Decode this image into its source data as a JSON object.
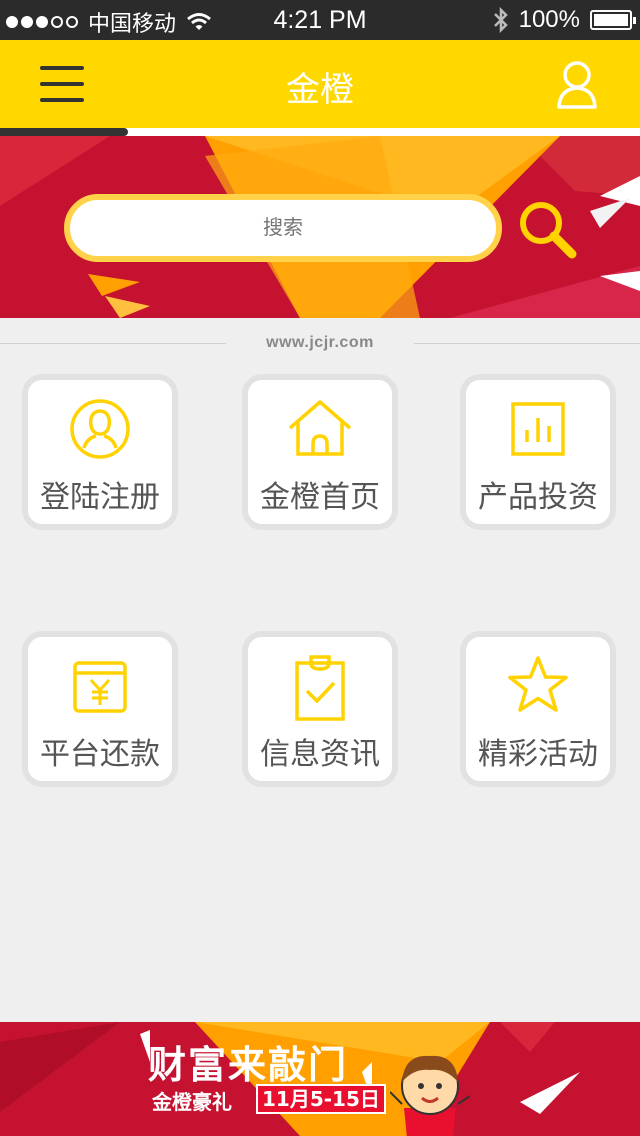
{
  "status_bar": {
    "carrier": "中国移动",
    "time": "4:21 PM",
    "battery": "100%"
  },
  "header": {
    "title": "金橙"
  },
  "search": {
    "placeholder": "搜索"
  },
  "site_url": "www.jcjr.com",
  "tiles": [
    {
      "label": "登陆注册",
      "icon": "user-circle-icon"
    },
    {
      "label": "金橙首页",
      "icon": "home-icon"
    },
    {
      "label": "产品投资",
      "icon": "bar-chart-icon"
    },
    {
      "label": "平台还款",
      "icon": "yuan-card-icon"
    },
    {
      "label": "信息资讯",
      "icon": "clipboard-check-icon"
    },
    {
      "label": "精彩活动",
      "icon": "star-icon"
    }
  ],
  "promo": {
    "title": "财富来敲门",
    "subtitle": "金橙豪礼",
    "date": "11月5-15日"
  },
  "colors": {
    "brand_yellow": "#ffd800",
    "banner_red": "#c8102e",
    "banner_orange": "#ffa000",
    "icon_yellow": "#ffd200"
  }
}
